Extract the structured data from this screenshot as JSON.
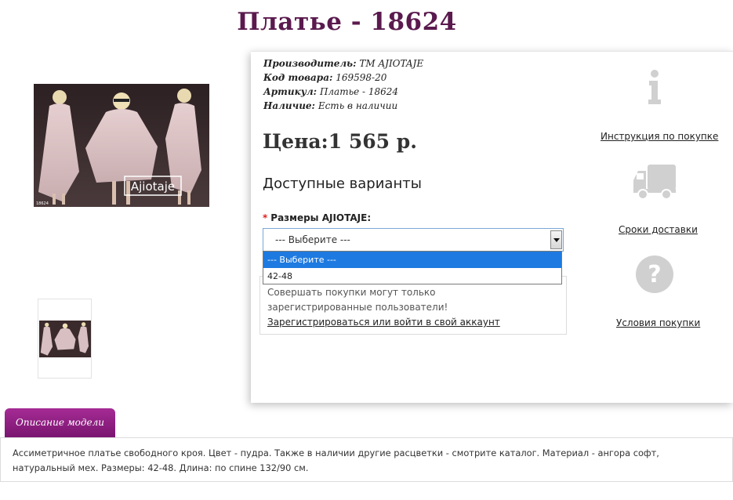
{
  "product": {
    "title": "Платье - 18624",
    "meta": [
      {
        "label": "Производитель:",
        "value": "ТМ AJIOTAJE"
      },
      {
        "label": "Код товара:",
        "value": "169598-20"
      },
      {
        "label": "Артикул:",
        "value": "Платье - 18624"
      },
      {
        "label": "Наличие:",
        "value": "Есть в наличии"
      }
    ],
    "price": "Цена:1 565 р.",
    "variants_title": "Доступные варианты",
    "size_label": "Размеры AJIOTAJE:",
    "size_select": {
      "value": "--- Выберите ---",
      "options": [
        "--- Выберите ---",
        "42-48"
      ]
    },
    "notice": {
      "text": "Совершать покупки могут только зарегистрированные пользователи!",
      "link": "Зарегистрироваться или войти в свой аккаунт"
    }
  },
  "gallery": {
    "watermark": "Ajiotaje",
    "small_code": "18624"
  },
  "side_links": [
    {
      "label": "Инструкция по покупке",
      "icon": "info-icon"
    },
    {
      "label": "Сроки доставки",
      "icon": "truck-icon"
    },
    {
      "label": "Условия покупки",
      "icon": "question-icon"
    }
  ],
  "tabs": {
    "description_label": "Описание модели"
  },
  "description": "Ассиметричное платье свободного кроя. Цвет - пудра. Также в наличии другие расцветки - смотрите каталог. Материал - ангора софт, натуральный мех. Размеры: 42-48. Длина: по спине 132/90 см.",
  "colors": {
    "title": "#5a1a4e",
    "tab": "#8e1f82",
    "select_highlight": "#1e7ae0",
    "icon_gray": "#d0d0d0"
  }
}
